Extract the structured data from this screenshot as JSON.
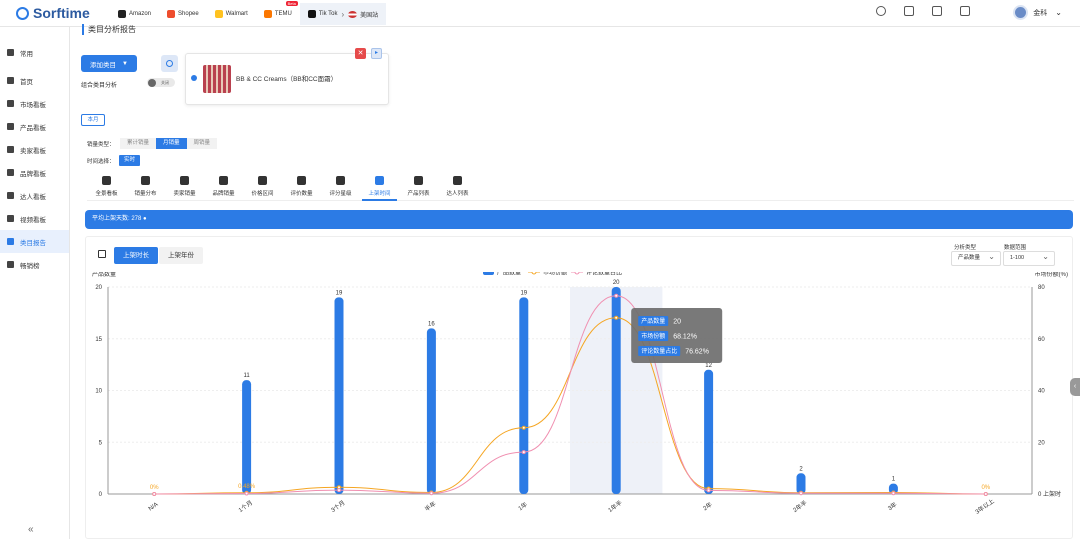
{
  "app": {
    "logo_text": "Sorftime"
  },
  "platforms": [
    {
      "label": "Amazon",
      "icon": "amazon-icon",
      "color": "#222"
    },
    {
      "label": "Shopee",
      "icon": "shopee-icon",
      "color": "#ee4d2d"
    },
    {
      "label": "Walmart",
      "icon": "walmart-icon",
      "color": "#ffc220"
    },
    {
      "label": "TEMU",
      "icon": "temu-icon",
      "color": "#fb7701",
      "badge": "Beta"
    },
    {
      "label": "Tik Tok",
      "icon": "tiktok-icon",
      "color": "#111"
    }
  ],
  "site": {
    "label": "美国站",
    "icon": "us-flag-icon"
  },
  "user": {
    "name": "金科"
  },
  "sidebar": {
    "items": [
      {
        "label": "常用",
        "icon": "shield-icon"
      },
      {
        "label": "首页",
        "icon": "home-icon"
      },
      {
        "label": "市场看板",
        "icon": "market-icon"
      },
      {
        "label": "产品看板",
        "icon": "product-icon"
      },
      {
        "label": "卖家看板",
        "icon": "seller-icon"
      },
      {
        "label": "品牌看板",
        "icon": "brand-icon"
      },
      {
        "label": "达人看板",
        "icon": "influencer-icon"
      },
      {
        "label": "视频看板",
        "icon": "video-icon"
      },
      {
        "label": "类目报告",
        "icon": "report-icon",
        "active": true
      },
      {
        "label": "畅销榜",
        "icon": "bestseller-icon"
      }
    ],
    "collapse_glyph": "«"
  },
  "page": {
    "title": "类目分析报告",
    "add_category_label": "添加类目",
    "combo_label": "组合类目分析",
    "toggle_label": "关闭",
    "card": {
      "product_name": "BB & CC Creams（BB和CC面霜）",
      "close_glyph": "✕",
      "next_glyph": "▸"
    },
    "month_tag": "本月"
  },
  "filters": {
    "sales_type_label": "销量类型：",
    "sales_types": [
      "累计销量",
      "月销量",
      "周销量"
    ],
    "sales_type_selected": "月销量",
    "time_label": "时间选择：",
    "time_value": "实时"
  },
  "tabs": [
    "全景看板",
    "销量分布",
    "卖家销量",
    "品牌销量",
    "价格区间",
    "评价数量",
    "评分星级",
    "上架时间",
    "产品列表",
    "达人列表"
  ],
  "tab_selected": "上架时间",
  "avg_listing": {
    "text": "平均上架天数: 278"
  },
  "chart_controls": {
    "btn_listing_duration": "上架时长",
    "btn_listing_year": "上架年份",
    "analysis_type_label": "分析类型",
    "analysis_type_value": "产品数量",
    "data_range_label": "数据范围",
    "data_range_value": "1-100"
  },
  "chart_data": {
    "type": "bar",
    "ylabel_left": "产品数量",
    "ylabel_right": "市场份额(%)",
    "categories": [
      "N/A",
      "1个月",
      "3个月",
      "半年",
      "1年",
      "1年半",
      "2年",
      "2年半",
      "3年",
      "3年以上"
    ],
    "y_left_ticks": [
      0,
      5,
      10,
      15,
      20
    ],
    "y_right_ticks": [
      0,
      20,
      40,
      60,
      80
    ],
    "y_right_extra_label": "上架时",
    "ylim_left": [
      0,
      20
    ],
    "ylim_right": [
      0,
      80
    ],
    "legend": [
      "产品数量",
      "市场份额",
      "评论数量占比"
    ],
    "colors": {
      "bar": "#2c7be5",
      "share": "#f5a623",
      "review": "#f08fb0",
      "highlight": "#eef1f8"
    },
    "series": [
      {
        "name": "产品数量",
        "kind": "bar",
        "values": [
          0,
          11,
          19,
          16,
          19,
          20,
          12,
          2,
          1,
          0
        ]
      },
      {
        "name": "市场份额",
        "kind": "line",
        "values": [
          0,
          0.48,
          2.6,
          0.6,
          25.6,
          68.12,
          2.1,
          0.5,
          0.6,
          0
        ]
      },
      {
        "name": "评论数量占比",
        "kind": "line",
        "values": [
          0,
          0.2,
          1.5,
          0.3,
          16.2,
          76.62,
          1.4,
          0.3,
          0.3,
          0
        ]
      }
    ],
    "data_labels": {
      "share": [
        "0%",
        "0.48%",
        "",
        "",
        "",
        "",
        "",
        "",
        "",
        "0%"
      ]
    },
    "highlight_index": 5,
    "tooltip": [
      {
        "label": "产品数量",
        "value": "20"
      },
      {
        "label": "市场份额",
        "value": "68.12%"
      },
      {
        "label": "评论数量占比",
        "value": "76.62%"
      }
    ]
  }
}
